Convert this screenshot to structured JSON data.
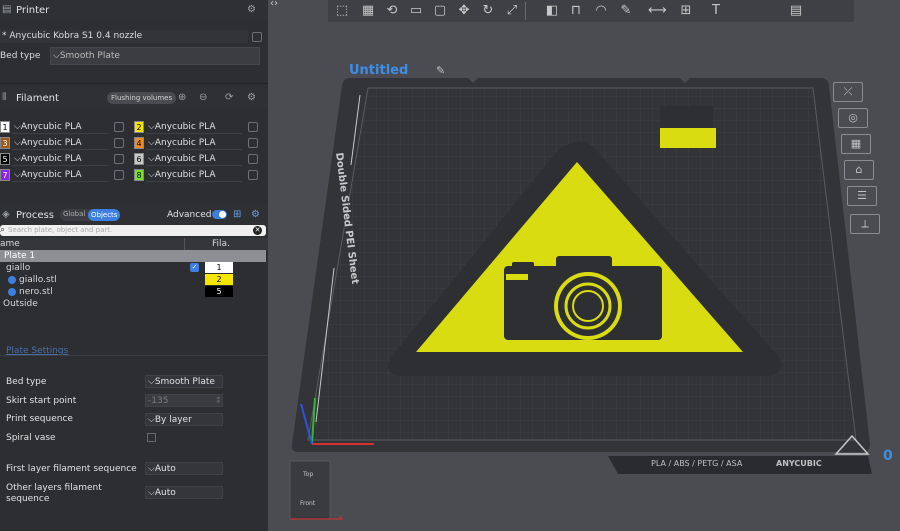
{
  "printer": {
    "title": "Printer",
    "name": "* Anycubic Kobra S1 0.4 nozzle",
    "bed_type_label": "Bed type",
    "bed_type_value": "Smooth Plate"
  },
  "filament": {
    "title": "Filament",
    "flushing_label": "Flushing volumes",
    "slots": [
      {
        "num": "1",
        "name": "Anycubic PLA",
        "color": "#ffffff"
      },
      {
        "num": "2",
        "name": "Anycubic PLA",
        "color": "#f5e600"
      },
      {
        "num": "3",
        "name": "Anycubic PLA",
        "color": "#a05a1e"
      },
      {
        "num": "4",
        "name": "Anycubic PLA",
        "color": "#f08a1e"
      },
      {
        "num": "5",
        "name": "Anycubic PLA",
        "color": "#000000"
      },
      {
        "num": "6",
        "name": "Anycubic PLA",
        "color": "#c8c8c8"
      },
      {
        "num": "7",
        "name": "Anycubic PLA",
        "color": "#8a28e0"
      },
      {
        "num": "8",
        "name": "Anycubic PLA",
        "color": "#7ae02a"
      }
    ]
  },
  "process": {
    "title": "Process",
    "global_label": "Global",
    "objects_label": "Objects",
    "advanced_label": "Advanced",
    "search_placeholder": "Search plate, object and part.",
    "col_name": "ame",
    "col_fila": "Fila.",
    "plate_label": "Plate 1",
    "objects": [
      {
        "name": "giallo",
        "fila": "1",
        "fila_color": "#ffffff"
      },
      {
        "name": "giallo.stl",
        "fila": "2",
        "fila_color": "#f5e600"
      },
      {
        "name": "nero.stl",
        "fila": "5",
        "fila_color": "#000000"
      }
    ],
    "outside_label": "Outside"
  },
  "plate_settings": {
    "title": "Plate Settings",
    "bed_type_label": "Bed type",
    "bed_type_value": "Smooth Plate",
    "skirt_label": "Skirt start point",
    "skirt_value": "-135",
    "print_seq_label": "Print sequence",
    "print_seq_value": "By layer",
    "spiral_label": "Spiral vase",
    "first_layer_label": "First layer filament sequence",
    "first_layer_value": "Auto",
    "other_layers_label_1": "Other layers filament",
    "other_layers_label_2": "sequence",
    "other_layers_value": "Auto"
  },
  "viewport": {
    "plate_title": "Untitled",
    "sheet_label": "Double Sided PEI Sheet",
    "material_label": "PLA / ABS / PETG / ASA",
    "brand_label": "ANYCUBIC",
    "cube_top": "Top",
    "cube_front": "Front",
    "axis_x": "x",
    "corner_num": "0",
    "sign_yellow": "#d8dc10",
    "sign_dark": "#2e2f33"
  }
}
